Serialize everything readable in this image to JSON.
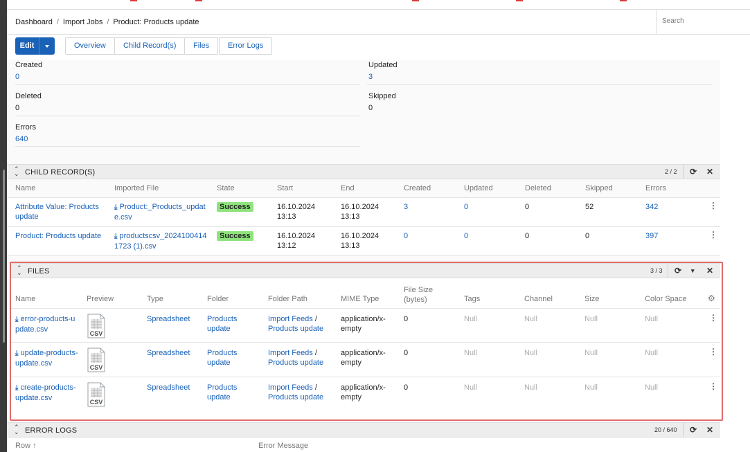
{
  "breadcrumb": {
    "items": [
      "Dashboard",
      "Import Jobs",
      "Product: Products update"
    ],
    "separator": "/"
  },
  "search": {
    "placeholder": "Search"
  },
  "toolbar": {
    "edit_label": "Edit",
    "tabs": [
      "Overview",
      "Child Record(s)",
      "Files",
      "Error Logs"
    ]
  },
  "stats": {
    "created": {
      "label": "Created",
      "value": "0"
    },
    "updated": {
      "label": "Updated",
      "value": "3"
    },
    "deleted": {
      "label": "Deleted",
      "value": "0"
    },
    "skipped": {
      "label": "Skipped",
      "value": "0"
    },
    "errors": {
      "label": "Errors",
      "value": "640"
    }
  },
  "child_records": {
    "title": "CHILD RECORD(S)",
    "count": "2 / 2",
    "columns": [
      "Name",
      "Imported File",
      "State",
      "Start",
      "End",
      "Created",
      "Updated",
      "Deleted",
      "Skipped",
      "Errors"
    ],
    "rows": [
      {
        "name_line1": "Attribute Value: Products",
        "name_line2": "update",
        "file_line1": "Product:_Products_updat",
        "file_line2": "e.csv",
        "state": "Success",
        "start_line1": "16.10.2024",
        "start_line2": "13:13",
        "end_line1": "16.10.2024",
        "end_line2": "13:13",
        "created": "3",
        "updated": "0",
        "deleted": "0",
        "skipped": "52",
        "errors": "342"
      },
      {
        "name_line1": "Product: Products update",
        "name_line2": "",
        "file_line1": "productscsv_2024100414",
        "file_line2": "1723 (1).csv",
        "state": "Success",
        "start_line1": "16.10.2024",
        "start_line2": "13:12",
        "end_line1": "16.10.2024",
        "end_line2": "13:13",
        "created": "0",
        "updated": "0",
        "deleted": "0",
        "skipped": "0",
        "errors": "397"
      }
    ]
  },
  "files": {
    "title": "FILES",
    "count": "3 / 3",
    "columns": {
      "name": "Name",
      "preview": "Preview",
      "type": "Type",
      "folder": "Folder",
      "folder_path": "Folder Path",
      "mime": "MIME Type",
      "size_line1": "File Size",
      "size_line2": "(bytes)",
      "tags": "Tags",
      "channel": "Channel",
      "size": "Size",
      "color_space": "Color Space"
    },
    "preview_label": "CSV",
    "rows": [
      {
        "name_line1": "error-products-u",
        "name_line2": "pdate.csv",
        "type": "Spreadsheet",
        "folder_line1": "Products",
        "folder_line2": "update",
        "path_line1": "Import Feeds",
        "path_sep": " /",
        "path_line2": "Products update",
        "mime_line1": "application/x-",
        "mime_line2": "empty",
        "file_size": "0",
        "tags": "Null",
        "channel": "Null",
        "size": "Null",
        "color_space": "Null"
      },
      {
        "name_line1": "update-products-",
        "name_line2": "update.csv",
        "type": "Spreadsheet",
        "folder_line1": "Products",
        "folder_line2": "update",
        "path_line1": "Import Feeds",
        "path_sep": " /",
        "path_line2": "Products update",
        "mime_line1": "application/x-",
        "mime_line2": "empty",
        "file_size": "0",
        "tags": "Null",
        "channel": "Null",
        "size": "Null",
        "color_space": "Null"
      },
      {
        "name_line1": "create-products-",
        "name_line2": "update.csv",
        "type": "Spreadsheet",
        "folder_line1": "Products",
        "folder_line2": "update",
        "path_line1": "Import Feeds",
        "path_sep": " /",
        "path_line2": "Products update",
        "mime_line1": "application/x-",
        "mime_line2": "empty",
        "file_size": "0",
        "tags": "Null",
        "channel": "Null",
        "size": "Null",
        "color_space": "Null"
      }
    ]
  },
  "error_logs": {
    "title": "ERROR LOGS",
    "count": "20 / 640",
    "columns": [
      "Row",
      "Error Message"
    ]
  },
  "colors": {
    "link": "#1a62b8",
    "success_badge": "#8fe37d",
    "highlight_border": "#e06a6a",
    "panel_header": "#ededed"
  },
  "icons": [
    "chevron-up-down-icon",
    "refresh-icon",
    "close-icon",
    "caret-down-icon",
    "kebab-menu-icon",
    "download-icon",
    "gear-icon",
    "csv-file-icon",
    "sort-asc-icon"
  ]
}
